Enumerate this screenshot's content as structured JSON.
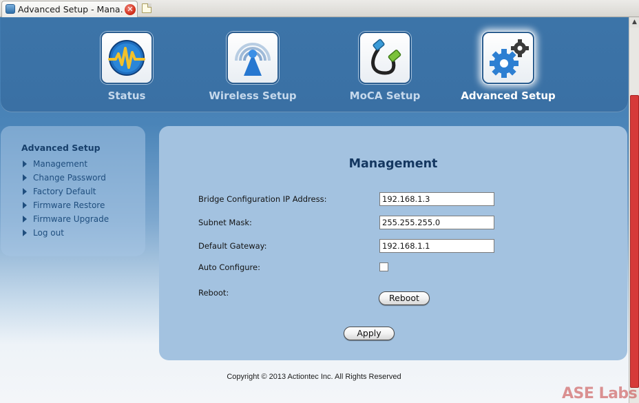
{
  "browser": {
    "tab_title": "Advanced Setup - Mana…",
    "close_glyph": "✕"
  },
  "nav": {
    "items": [
      {
        "label": "Status",
        "icon": "waveform-icon",
        "active": false
      },
      {
        "label": "Wireless Setup",
        "icon": "wireless-antenna-icon",
        "active": false
      },
      {
        "label": "MoCA Setup",
        "icon": "cable-icon",
        "active": false
      },
      {
        "label": "Advanced Setup",
        "icon": "gears-icon",
        "active": true
      }
    ]
  },
  "sidebar": {
    "title": "Advanced Setup",
    "items": [
      {
        "label": "Management"
      },
      {
        "label": "Change Password"
      },
      {
        "label": "Factory Default"
      },
      {
        "label": "Firmware Restore"
      },
      {
        "label": "Firmware Upgrade"
      },
      {
        "label": "Log out"
      }
    ]
  },
  "main": {
    "title": "Management",
    "fields": {
      "bridge_ip": {
        "label": "Bridge Configuration IP Address:",
        "value": "192.168.1.3"
      },
      "subnet_mask": {
        "label": "Subnet Mask:",
        "value": "255.255.255.0"
      },
      "gateway": {
        "label": "Default Gateway:",
        "value": "192.168.1.1"
      },
      "auto_configure": {
        "label": "Auto Configure:",
        "checked": false
      },
      "reboot": {
        "label": "Reboot:",
        "button_label": "Reboot"
      }
    },
    "apply_label": "Apply"
  },
  "footer": {
    "copyright": "Copyright © 2013 Actiontec Inc. All Rights Reserved"
  },
  "watermark": "ASE Labs",
  "colors": {
    "nav_bg": "#3c74a8",
    "panel_bg": "#a3c2e0",
    "title_text": "#143760",
    "scroll_thumb": "#d63a3a"
  }
}
